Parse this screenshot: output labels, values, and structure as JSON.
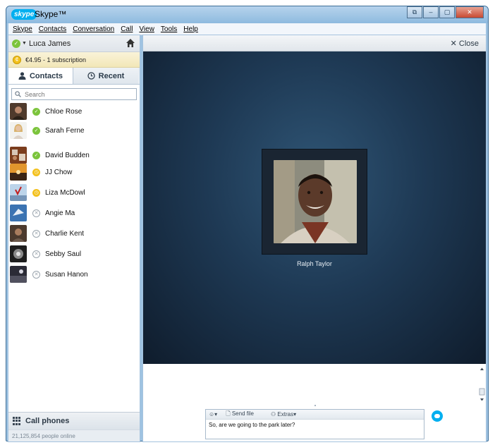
{
  "window": {
    "logo": "skype",
    "title": "Skype™",
    "controls": [
      "⧉",
      "–",
      "▢",
      "✕"
    ]
  },
  "menu": [
    "Skype",
    "Contacts",
    "Conversation",
    "Call",
    "View",
    "Tools",
    "Help"
  ],
  "profile": {
    "name": "Luca James",
    "status": "online"
  },
  "credit": {
    "text": "€4.95 - 1 subscription"
  },
  "tabs": {
    "contacts": "Contacts",
    "recent": "Recent"
  },
  "search": {
    "placeholder": "Search"
  },
  "contacts": [
    {
      "name": "Chloe Rose",
      "status": "online"
    },
    {
      "name": "Sarah Ferne",
      "status": "online"
    },
    {
      "name": "David Budden",
      "status": "online"
    },
    {
      "name": "JJ Chow",
      "status": "away"
    },
    {
      "name": "Liza McDowl",
      "status": "away"
    },
    {
      "name": "Angie Ma",
      "status": "offline"
    },
    {
      "name": "Charlie Kent",
      "status": "offline"
    },
    {
      "name": "Sebby Saul",
      "status": "offline"
    },
    {
      "name": "Susan Hanon",
      "status": "offline"
    }
  ],
  "call_phones": {
    "label": "Call phones"
  },
  "online_count": "21,125,854 people online",
  "conversation": {
    "close_label": "Close",
    "caller_name": "Ralph Taylor",
    "tools": {
      "emoticon": "☺▾",
      "send_file": "Send file",
      "extras": "Extras▾"
    },
    "message_draft": "So, are we going to the park later?"
  },
  "colors": {
    "accent": "#00aff0",
    "online": "#7cc43c",
    "away": "#f3c11e"
  }
}
